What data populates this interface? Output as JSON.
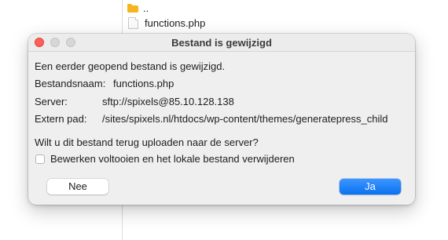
{
  "browser": {
    "parent_dir": "..",
    "file": "functions.php"
  },
  "dialog": {
    "title": "Bestand is gewijzigd",
    "message": "Een eerder geopend bestand is gewijzigd.",
    "filename_label": "Bestandsnaam:",
    "filename_value": "functions.php",
    "server_label": "Server:",
    "server_value": "sftp://spixels@85.10.128.138",
    "remote_path_label": "Extern pad:",
    "remote_path_value": "/sites/spixels.nl/htdocs/wp-content/themes/generatepress_child",
    "question": "Wilt u dit bestand terug uploaden naar de server?",
    "checkbox_label": "Bewerken voltooien en het lokale bestand verwijderen",
    "checkbox_checked": false,
    "no_button": "Nee",
    "yes_button": "Ja"
  },
  "colors": {
    "close": "#ff5f57",
    "primary": "#0a72ef",
    "folder": "#f6b51f"
  }
}
